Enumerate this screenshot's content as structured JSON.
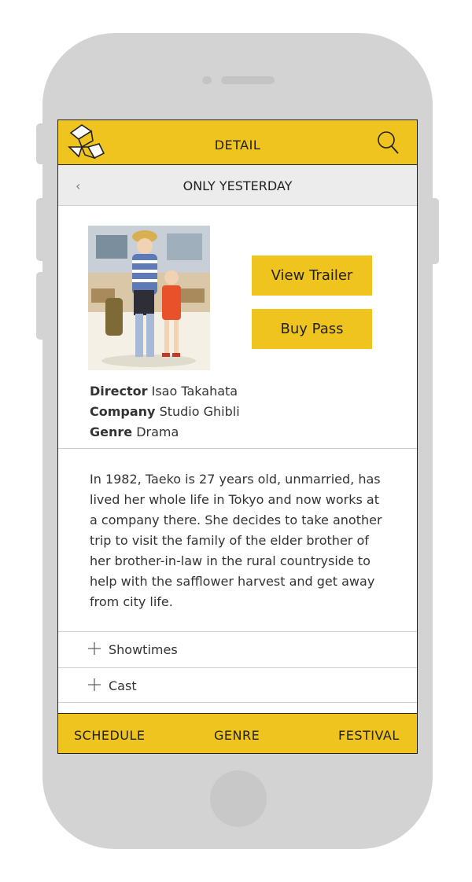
{
  "header": {
    "title": "DETAIL"
  },
  "subheader": {
    "title": "ONLY YESTERDAY"
  },
  "actions": {
    "trailer_label": "View Trailer",
    "buy_label": "Buy Pass"
  },
  "details": {
    "director_label": "Director",
    "director_value": "Isao Takahata",
    "company_label": "Company",
    "company_value": "Studio Ghibli",
    "genre_label": "Genre",
    "genre_value": "Drama"
  },
  "synopsis": "In 1982, Taeko is 27 years old, unmarried, has lived her whole life in Tokyo and now works at a company there. She decides to take another trip to visit the family of the elder brother of her brother-in-law in the rural countryside to help with the safflower harvest and get away from city life.",
  "accordion": {
    "showtimes_label": "Showtimes",
    "cast_label": "Cast"
  },
  "tabs": {
    "schedule": "SCHEDULE",
    "genre": "GENRE",
    "festival": "FESTIVAL"
  },
  "icons": {
    "logo": "folded-paper-logo-icon",
    "search": "search-icon",
    "back": "chevron-left-icon",
    "expand": "plus-icon"
  },
  "colors": {
    "accent": "#efc41e",
    "frame": "#d3d3d3",
    "subheader_bg": "#ececec"
  }
}
